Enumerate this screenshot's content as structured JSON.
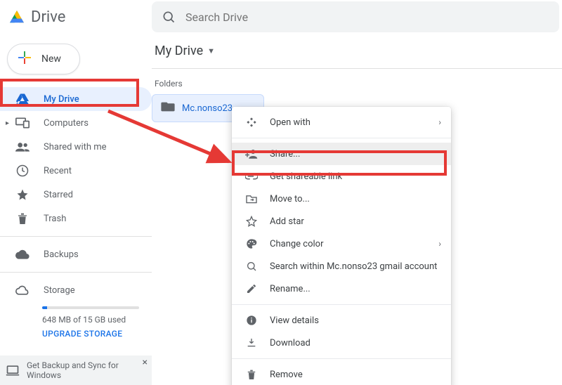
{
  "brand": {
    "title": "Drive"
  },
  "search": {
    "placeholder": "Search Drive"
  },
  "new_button": {
    "label": "New"
  },
  "sidebar": {
    "items": [
      {
        "label": "My Drive"
      },
      {
        "label": "Computers"
      },
      {
        "label": "Shared with me"
      },
      {
        "label": "Recent"
      },
      {
        "label": "Starred"
      },
      {
        "label": "Trash"
      }
    ],
    "backups": {
      "label": "Backups"
    },
    "storage": {
      "label": "Storage",
      "used_text": "648 MB of 15 GB used",
      "upgrade_label": "UPGRADE STORAGE"
    }
  },
  "main": {
    "breadcrumb": "My Drive",
    "section_label": "Folders",
    "folder_name": "Mc.nonso23..."
  },
  "context_menu": {
    "open_with": "Open with",
    "share": "Share...",
    "get_link": "Get shareable link",
    "move_to": "Move to...",
    "add_star": "Add star",
    "change_color": "Change color",
    "search_within": "Search within Mc.nonso23 gmail account",
    "rename": "Rename...",
    "view_details": "View details",
    "download": "Download",
    "remove": "Remove"
  },
  "promo": {
    "text": "Get Backup and Sync for Windows"
  },
  "colors": {
    "accent": "#1a73e8",
    "highlight": "#e53935"
  }
}
